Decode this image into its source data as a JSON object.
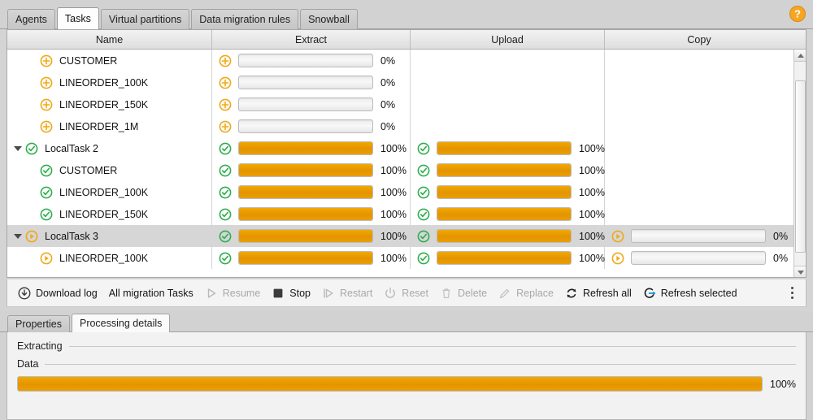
{
  "window": {
    "tabs": [
      {
        "label": "Agents",
        "active": false
      },
      {
        "label": "Tasks",
        "active": true
      },
      {
        "label": "Virtual partitions",
        "active": false
      },
      {
        "label": "Data migration rules",
        "active": false
      },
      {
        "label": "Snowball",
        "active": false
      }
    ],
    "help_icon": "help-circle-icon"
  },
  "table": {
    "columns": [
      {
        "key": "name",
        "label": "Name"
      },
      {
        "key": "extract",
        "label": "Extract"
      },
      {
        "key": "upload",
        "label": "Upload"
      },
      {
        "key": "copy",
        "label": "Copy"
      }
    ],
    "rows": [
      {
        "name": "CUSTOMER",
        "level": "child",
        "expander": "none",
        "status_icon": "plus-circle-icon",
        "selected": false,
        "extract": {
          "icon": "plus-circle-icon",
          "percent": 0,
          "label": "0%"
        },
        "upload": null,
        "copy": null
      },
      {
        "name": "LINEORDER_100K",
        "level": "child",
        "expander": "none",
        "status_icon": "plus-circle-icon",
        "selected": false,
        "extract": {
          "icon": "plus-circle-icon",
          "percent": 0,
          "label": "0%"
        },
        "upload": null,
        "copy": null
      },
      {
        "name": "LINEORDER_150K",
        "level": "child",
        "expander": "none",
        "status_icon": "plus-circle-icon",
        "selected": false,
        "extract": {
          "icon": "plus-circle-icon",
          "percent": 0,
          "label": "0%"
        },
        "upload": null,
        "copy": null
      },
      {
        "name": "LINEORDER_1M",
        "level": "child",
        "expander": "none",
        "status_icon": "plus-circle-icon",
        "selected": false,
        "extract": {
          "icon": "plus-circle-icon",
          "percent": 0,
          "label": "0%"
        },
        "upload": null,
        "copy": null
      },
      {
        "name": "LocalTask 2",
        "level": "parent",
        "expander": "expanded",
        "status_icon": "check-circle-icon",
        "selected": false,
        "extract": {
          "icon": "check-circle-icon",
          "percent": 100,
          "label": "100%"
        },
        "upload": {
          "icon": "check-circle-icon",
          "percent": 100,
          "label": "100%"
        },
        "copy": null
      },
      {
        "name": "CUSTOMER",
        "level": "child",
        "expander": "none",
        "status_icon": "check-circle-icon",
        "selected": false,
        "extract": {
          "icon": "check-circle-icon",
          "percent": 100,
          "label": "100%"
        },
        "upload": {
          "icon": "check-circle-icon",
          "percent": 100,
          "label": "100%"
        },
        "copy": null
      },
      {
        "name": "LINEORDER_100K",
        "level": "child",
        "expander": "none",
        "status_icon": "check-circle-icon",
        "selected": false,
        "extract": {
          "icon": "check-circle-icon",
          "percent": 100,
          "label": "100%"
        },
        "upload": {
          "icon": "check-circle-icon",
          "percent": 100,
          "label": "100%"
        },
        "copy": null
      },
      {
        "name": "LINEORDER_150K",
        "level": "child",
        "expander": "none",
        "status_icon": "check-circle-icon",
        "selected": false,
        "extract": {
          "icon": "check-circle-icon",
          "percent": 100,
          "label": "100%"
        },
        "upload": {
          "icon": "check-circle-icon",
          "percent": 100,
          "label": "100%"
        },
        "copy": null
      },
      {
        "name": "LocalTask 3",
        "level": "parent",
        "expander": "expanded",
        "status_icon": "play-circle-icon",
        "selected": true,
        "extract": {
          "icon": "check-circle-icon",
          "percent": 100,
          "label": "100%"
        },
        "upload": {
          "icon": "check-circle-icon",
          "percent": 100,
          "label": "100%"
        },
        "copy": {
          "icon": "play-circle-icon",
          "percent": 0,
          "label": "0%"
        }
      },
      {
        "name": "LINEORDER_100K",
        "level": "child",
        "expander": "none",
        "status_icon": "play-circle-icon",
        "selected": false,
        "extract": {
          "icon": "check-circle-icon",
          "percent": 100,
          "label": "100%"
        },
        "upload": {
          "icon": "check-circle-icon",
          "percent": 100,
          "label": "100%"
        },
        "copy": {
          "icon": "play-circle-icon",
          "percent": 0,
          "label": "0%"
        }
      }
    ],
    "scrollbar": {
      "orientation": "vertical",
      "up_arrow": "chevron-up-icon",
      "down_arrow": "chevron-down-icon"
    }
  },
  "toolbar": {
    "items": [
      {
        "label": "Download log",
        "icon": "download-icon",
        "enabled": true
      },
      {
        "label": "All migration Tasks",
        "icon": "none",
        "enabled": true
      },
      {
        "label": "Resume",
        "icon": "play-icon",
        "enabled": false
      },
      {
        "label": "Stop",
        "icon": "stop-square-icon",
        "enabled": true
      },
      {
        "label": "Restart",
        "icon": "restart-play-icon",
        "enabled": false
      },
      {
        "label": "Reset",
        "icon": "power-icon",
        "enabled": false
      },
      {
        "label": "Delete",
        "icon": "trash-icon",
        "enabled": false
      },
      {
        "label": "Replace",
        "icon": "pencil-icon",
        "enabled": false
      },
      {
        "label": "Refresh all",
        "icon": "refresh-icon",
        "enabled": true
      },
      {
        "label": "Refresh selected",
        "icon": "refresh-selected-icon",
        "enabled": true
      }
    ],
    "overflow_icon": "kebab-menu-icon"
  },
  "details": {
    "tabs": [
      {
        "label": "Properties",
        "active": false
      },
      {
        "label": "Processing details",
        "active": true
      }
    ],
    "sections": [
      {
        "title": "Extracting"
      },
      {
        "title": "Data"
      }
    ],
    "progress": {
      "percent": 100,
      "label": "100%"
    }
  },
  "colors": {
    "accent_orange": "#e59400",
    "success_green": "#2eae4e",
    "refresh_blue": "#1a8fd4",
    "selection_gray": "#d6d6d6"
  }
}
